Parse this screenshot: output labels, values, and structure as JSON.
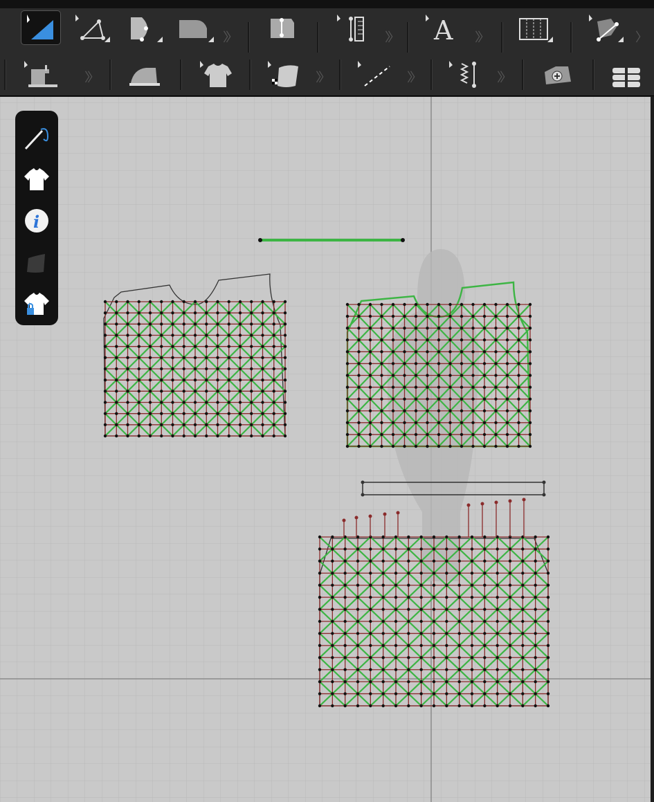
{
  "toolbar_top": {
    "tools": [
      {
        "name": "edit-pattern-tool",
        "icon": "blue-triangle-select-icon",
        "active": true
      },
      {
        "name": "transform-pattern-tool",
        "icon": "triangle-points-icon",
        "active": false
      },
      {
        "name": "edit-curvature-tool",
        "icon": "curve-shape-icon",
        "active": false
      },
      {
        "name": "polygon-tool",
        "icon": "pattern-piece-icon",
        "active": false
      },
      {
        "name": "internal-shape-tool",
        "icon": "internal-line-icon",
        "active": false
      },
      {
        "name": "ruler-tool",
        "icon": "ruler-icon",
        "active": false
      },
      {
        "name": "text-tool",
        "icon": "text-a-icon",
        "active": false
      },
      {
        "name": "grading-tool",
        "icon": "grading-lines-icon",
        "active": false
      },
      {
        "name": "fold-tool",
        "icon": "fold-pattern-icon",
        "active": false
      }
    ],
    "text_tool_glyph": "A"
  },
  "toolbar_bottom": {
    "tools": [
      {
        "name": "sewing-tool",
        "icon": "sewing-machine-icon"
      },
      {
        "name": "steam-tool",
        "icon": "iron-icon"
      },
      {
        "name": "garment-tool",
        "icon": "tshirt-select-icon"
      },
      {
        "name": "fabric-tool",
        "icon": "fabric-texture-icon"
      },
      {
        "name": "topstitch-tool",
        "icon": "dashed-line-icon"
      },
      {
        "name": "elastic-tool",
        "icon": "elastic-zigzag-icon"
      },
      {
        "name": "add-pattern-tool",
        "icon": "add-pattern-icon"
      },
      {
        "name": "stack-tool",
        "icon": "stacked-garment-icon"
      }
    ]
  },
  "side_panel": {
    "items": [
      {
        "name": "sewing-needle",
        "icon": "needle-thread-icon"
      },
      {
        "name": "show-garment",
        "icon": "white-tshirt-icon"
      },
      {
        "name": "info",
        "icon": "info-icon",
        "label": "i"
      },
      {
        "name": "fabric-swatch",
        "icon": "dark-fabric-icon"
      },
      {
        "name": "lock-garment",
        "icon": "locked-tshirt-icon"
      }
    ]
  },
  "colors": {
    "mesh_red": "#8a2b2b",
    "mesh_green": "#3db544",
    "vertex_black": "#111111",
    "avatar_gray": "#b8b8b8",
    "grid_bg": "#c9c9c9",
    "accent_blue": "#3a8fe0"
  }
}
